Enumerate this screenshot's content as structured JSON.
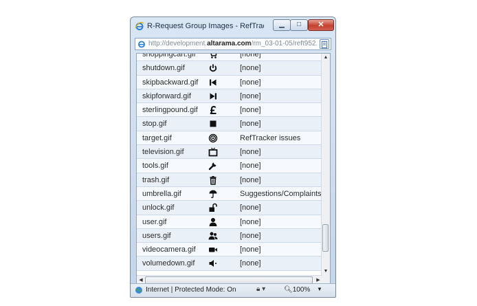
{
  "window": {
    "title": "R-Request Group Images - RefTracker - T...",
    "address_prefix": "http://development.",
    "address_domain": "altarama.com",
    "address_suffix": "/rm_03-01-05/reft952."
  },
  "images": [
    {
      "file": "shoppingcart.gif",
      "icon": "shopping-cart-icon",
      "group": "[none]"
    },
    {
      "file": "shutdown.gif",
      "icon": "power-icon",
      "group": "[none]"
    },
    {
      "file": "skipbackward.gif",
      "icon": "skip-backward-icon",
      "group": "[none]"
    },
    {
      "file": "skipforward.gif",
      "icon": "skip-forward-icon",
      "group": "[none]"
    },
    {
      "file": "sterlingpound.gif",
      "icon": "pound-sterling-icon",
      "group": "[none]"
    },
    {
      "file": "stop.gif",
      "icon": "stop-icon",
      "group": "[none]"
    },
    {
      "file": "target.gif",
      "icon": "target-icon",
      "group": "RefTracker issues"
    },
    {
      "file": "television.gif",
      "icon": "television-icon",
      "group": "[none]"
    },
    {
      "file": "tools.gif",
      "icon": "wrench-icon",
      "group": "[none]"
    },
    {
      "file": "trash.gif",
      "icon": "trash-icon",
      "group": "[none]"
    },
    {
      "file": "umbrella.gif",
      "icon": "umbrella-icon",
      "group": "Suggestions/Complaints"
    },
    {
      "file": "unlock.gif",
      "icon": "unlock-icon",
      "group": "[none]"
    },
    {
      "file": "user.gif",
      "icon": "user-icon",
      "group": "[none]"
    },
    {
      "file": "users.gif",
      "icon": "users-icon",
      "group": "[none]"
    },
    {
      "file": "videocamera.gif",
      "icon": "video-camera-icon",
      "group": "[none]"
    },
    {
      "file": "volumedown.gif",
      "icon": "volume-down-icon",
      "group": "[none]"
    }
  ],
  "status": {
    "zone": "Internet | Protected Mode: On",
    "zoom": "100%"
  }
}
